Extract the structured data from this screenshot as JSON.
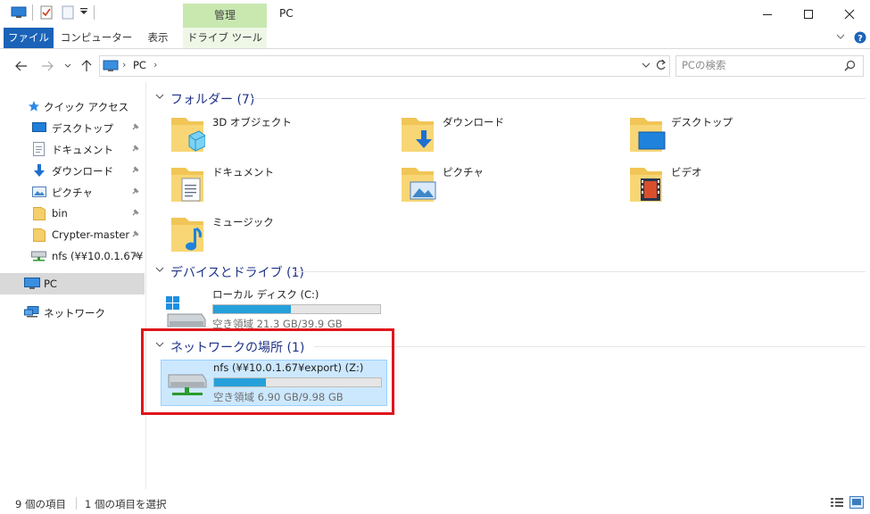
{
  "window": {
    "title": "PC",
    "context_tab": "管理"
  },
  "ribbon": {
    "tabs": [
      "ファイル",
      "コンピューター",
      "表示",
      "ドライブ ツール"
    ]
  },
  "address": {
    "path": [
      "PC"
    ]
  },
  "search": {
    "placeholder": "PCの検索"
  },
  "sidebar": {
    "quick_access": "クイック アクセス",
    "pinned": [
      {
        "label": "デスクトップ",
        "icon": "desktop-icon"
      },
      {
        "label": "ドキュメント",
        "icon": "document-icon"
      },
      {
        "label": "ダウンロード",
        "icon": "download-icon"
      },
      {
        "label": "ピクチャ",
        "icon": "picture-icon"
      },
      {
        "label": "bin",
        "icon": "folder-icon"
      },
      {
        "label": "Crypter-master",
        "icon": "folder-icon"
      },
      {
        "label": "nfs (¥¥10.0.1.67¥",
        "icon": "network-drive-icon"
      }
    ],
    "pc": "PC",
    "network": "ネットワーク"
  },
  "content": {
    "folders_header": "フォルダー (7)",
    "folders": [
      {
        "label": "3D オブジェクト",
        "icon": "3d-objects-folder-icon"
      },
      {
        "label": "ダウンロード",
        "icon": "downloads-folder-icon"
      },
      {
        "label": "デスクトップ",
        "icon": "desktop-folder-icon"
      },
      {
        "label": "ドキュメント",
        "icon": "documents-folder-icon"
      },
      {
        "label": "ピクチャ",
        "icon": "pictures-folder-icon"
      },
      {
        "label": "ビデオ",
        "icon": "videos-folder-icon"
      },
      {
        "label": "ミュージック",
        "icon": "music-folder-icon"
      }
    ],
    "devices_header": "デバイスとドライブ (1)",
    "local_drive": {
      "label": "ローカル ディスク (C:)",
      "free": "空き領域 21.3 GB/39.9 GB",
      "used_fraction": 0.466
    },
    "network_header": "ネットワークの場所 (1)",
    "network_drive": {
      "label": "nfs (¥¥10.0.1.67¥export) (Z:)",
      "free": "空き領域 6.90 GB/9.98 GB",
      "used_fraction": 0.309
    }
  },
  "status": {
    "count": "9 個の項目",
    "selected": "1 個の項目を選択"
  },
  "colors": {
    "accent": "#1a63b8",
    "manage_tab": "#c9e8b0",
    "header_text": "#1e3287",
    "drive_fill": "#26a0da",
    "highlight": "#e0151b"
  }
}
